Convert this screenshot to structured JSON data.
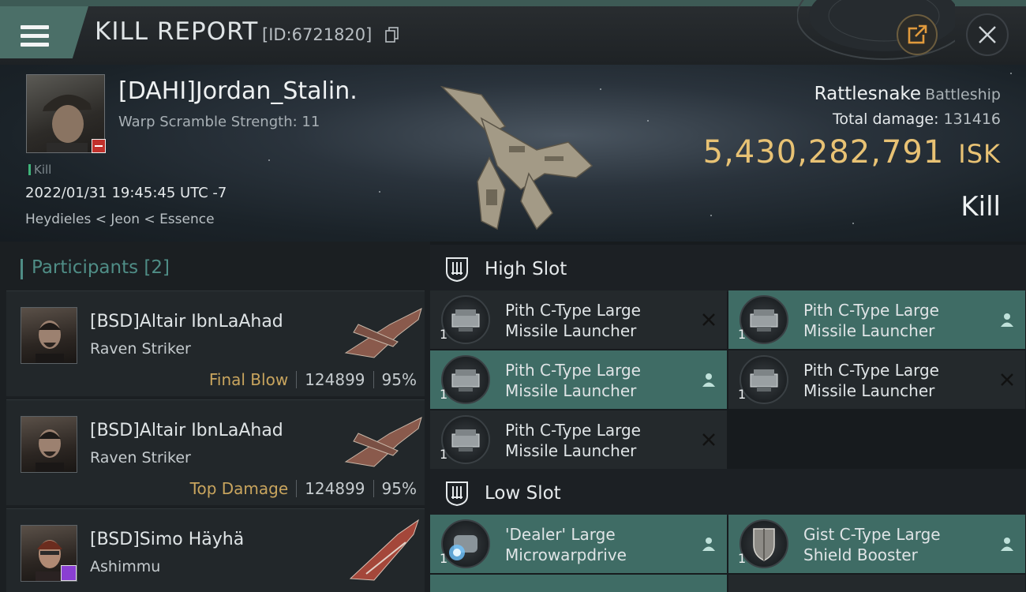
{
  "header": {
    "title": "KILL REPORT",
    "report_id": "[ID:6721820]"
  },
  "victim": {
    "name": "[DAHI]Jordan_Stalin.",
    "warp_scramble": "Warp Scramble Strength: 11",
    "kill_tag": "Kill",
    "timestamp": "2022/01/31 19:45:45 UTC -7",
    "location": "Heydieles < Jeon < Essence",
    "ship_name": "Rattlesnake",
    "ship_class": "Battleship",
    "total_damage_label": "Total damage:",
    "total_damage_value": "131416",
    "isk_value": "5,430,282,791",
    "isk_unit": "ISK",
    "result": "Kill"
  },
  "participants": {
    "heading": "Participants [2]",
    "rows": [
      {
        "name": "[BSD]Altair IbnLaAhad",
        "ship": "Raven Striker",
        "tag": "Final Blow",
        "damage": "124899",
        "percent": "95%"
      },
      {
        "name": "[BSD]Altair IbnLaAhad",
        "ship": "Raven Striker",
        "tag": "Top Damage",
        "damage": "124899",
        "percent": "95%"
      },
      {
        "name": "[BSD]Simo Häyhä",
        "ship": "Ashimmu",
        "tag": "",
        "damage": "",
        "percent": ""
      }
    ]
  },
  "slots": {
    "high_slot_label": "High Slot",
    "low_slot_label": "Low Slot",
    "high_items": [
      {
        "line1": "Pith C-Type Large",
        "line2": "Missile Launcher",
        "qty": "1",
        "status": "destroyed"
      },
      {
        "line1": "Pith C-Type Large",
        "line2": "Missile Launcher",
        "qty": "1",
        "status": "dropped"
      },
      {
        "line1": "Pith C-Type Large",
        "line2": "Missile Launcher",
        "qty": "1",
        "status": "dropped"
      },
      {
        "line1": "Pith C-Type Large",
        "line2": "Missile Launcher",
        "qty": "1",
        "status": "destroyed"
      },
      {
        "line1": "Pith C-Type Large",
        "line2": "Missile Launcher",
        "qty": "1",
        "status": "destroyed"
      }
    ],
    "low_items": [
      {
        "line1": "'Dealer' Large",
        "line2": "Microwarpdrive",
        "qty": "1",
        "status": "dropped"
      },
      {
        "line1": "Gist C-Type Large",
        "line2": "Shield Booster",
        "qty": "1",
        "status": "dropped"
      }
    ]
  },
  "colors": {
    "accent_teal": "#4f8d86",
    "dropped_bg": "#3f6c65",
    "isk_gold": "#e8c274",
    "tag_gold": "#c9a55e"
  }
}
